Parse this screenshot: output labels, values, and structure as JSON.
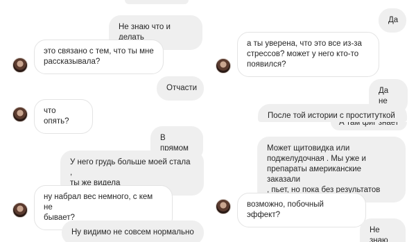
{
  "left": {
    "messages": [
      {
        "side": "out",
        "text": "Не знаю что и делать"
      },
      {
        "side": "in",
        "text": "это связано с тем, что ты мне\nрассказывала?"
      },
      {
        "side": "out",
        "text": "Отчасти"
      },
      {
        "side": "in",
        "text": "что опять?"
      },
      {
        "side": "out",
        "text": "В прямом"
      },
      {
        "side": "out",
        "text": "У него грудь больше моей стала ,\nты же видела"
      },
      {
        "side": "in",
        "text": "ну набрал вес немного, с кем не\nбывает?"
      },
      {
        "side": "out",
        "text": "Ну видимо не совсем нормально"
      }
    ]
  },
  "right": {
    "messages": [
      {
        "side": "out",
        "text": "Да"
      },
      {
        "side": "in",
        "text": "а ты уверена, что это все из-за\nстрессов? может у него кто-то\nпоявился?"
      },
      {
        "side": "out",
        "text": "Да не"
      },
      {
        "side": "out",
        "text": "После той истории с проституткой"
      },
      {
        "side": "out",
        "text": "А там фиг знает"
      },
      {
        "side": "out",
        "text": "Может щитовидка или\nподжелудочная . Мы уже и\nпрепараты американские заказали\n, пьет, но пока без результатов"
      },
      {
        "side": "in",
        "text": "возможно, побочный эффект?"
      },
      {
        "side": "out",
        "text": "Не знаю"
      }
    ]
  }
}
